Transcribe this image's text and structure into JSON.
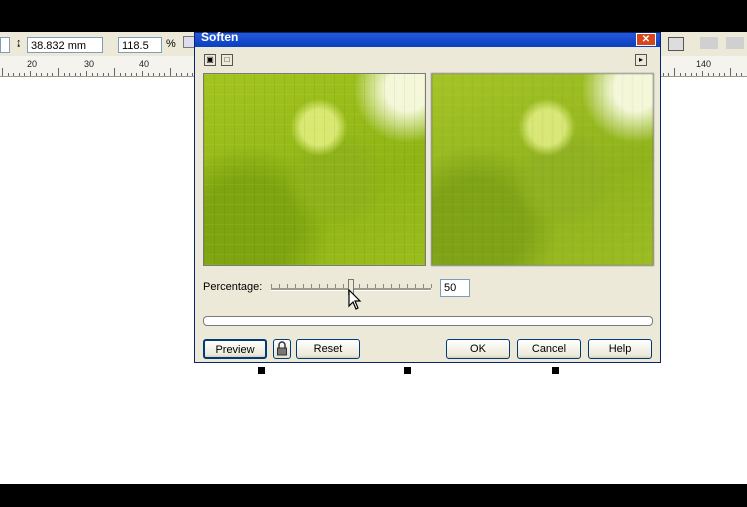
{
  "app": {
    "dimension_value": "38.832 mm",
    "scale_value": "118.5",
    "scale_unit": "%",
    "ruler_numbers": [
      "20",
      "30",
      "40",
      "140"
    ]
  },
  "dialog": {
    "title": "Soften",
    "close_glyph": "✕",
    "percentage_label": "Percentage:",
    "percentage_value": "50",
    "slider_level_percent": 50,
    "buttons": {
      "preview": "Preview",
      "reset": "Reset",
      "ok": "OK",
      "cancel": "Cancel",
      "help": "Help"
    }
  },
  "icons": {
    "dual_preview": "dual-preview-icon",
    "single_preview": "single-preview-icon",
    "flyout": "flyout-arrow-icon",
    "lock": "lock-icon",
    "cursor": "mouse-cursor-icon"
  },
  "colors": {
    "titlebar": "#0a3fc0",
    "close": "#d6461c",
    "dialog_bg": "#ece9d8",
    "image_green": "#9bbd1c"
  }
}
